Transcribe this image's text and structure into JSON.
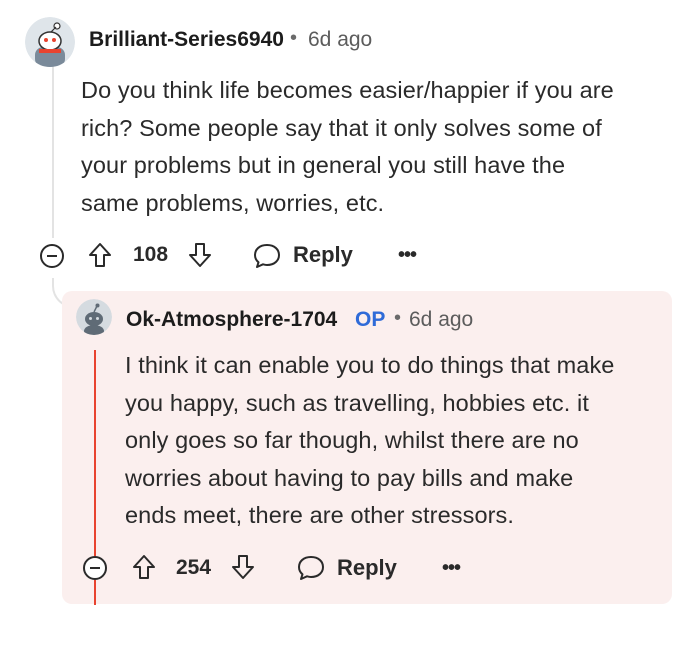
{
  "comment": {
    "username": "Brilliant-Series6940",
    "time": "6d ago",
    "body_lines": [
      "Do you think life becomes easier/happier if you are",
      "rich? Some people say that it only solves some of",
      "your problems but in general you still have the",
      "same problems, worries, etc."
    ],
    "votes": "108",
    "reply_label": "Reply",
    "more_label": "•••"
  },
  "reply": {
    "username": "Ok-Atmosphere-1704",
    "op_badge": "OP",
    "time": "6d ago",
    "body_lines": [
      "I think it can enable you to do things that make",
      "you happy, such as travelling, hobbies etc. it",
      "only goes so far though, whilst there are no",
      "worries about having to pay bills and make",
      "ends meet, there are other stressors."
    ],
    "votes": "254",
    "reply_label": "Reply",
    "more_label": "•••"
  },
  "colors": {
    "op_badge": "#2f6bd8",
    "reply_background": "#fbefee",
    "thread_highlight": "#e8432f"
  }
}
